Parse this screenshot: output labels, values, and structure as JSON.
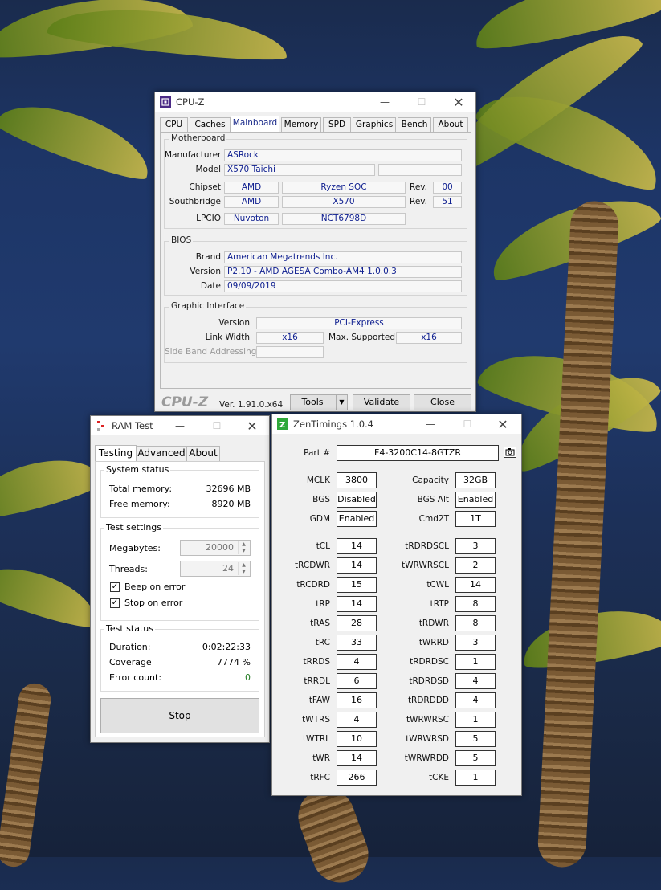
{
  "cpuz": {
    "title": "CPU-Z",
    "tabs": [
      "CPU",
      "Caches",
      "Mainboard",
      "Memory",
      "SPD",
      "Graphics",
      "Bench",
      "About"
    ],
    "selected_tab": "Mainboard",
    "motherboard": {
      "group": "Motherboard",
      "manufacturer_label": "Manufacturer",
      "manufacturer": "ASRock",
      "model_label": "Model",
      "model": "X570 Taichi",
      "chipset_label": "Chipset",
      "chipset_vendor": "AMD",
      "chipset_name": "Ryzen SOC",
      "chipset_rev_label": "Rev.",
      "chipset_rev": "00",
      "southbridge_label": "Southbridge",
      "southbridge_vendor": "AMD",
      "southbridge_name": "X570",
      "southbridge_rev_label": "Rev.",
      "southbridge_rev": "51",
      "lpcio_label": "LPCIO",
      "lpcio_vendor": "Nuvoton",
      "lpcio_name": "NCT6798D"
    },
    "bios": {
      "group": "BIOS",
      "brand_label": "Brand",
      "brand": "American Megatrends Inc.",
      "version_label": "Version",
      "version": "P2.10 - AMD AGESA Combo-AM4 1.0.0.3",
      "date_label": "Date",
      "date": "09/09/2019"
    },
    "graphic": {
      "group": "Graphic Interface",
      "version_label": "Version",
      "version": "PCI-Express",
      "link_label": "Link Width",
      "link": "x16",
      "max_label": "Max. Supported",
      "max": "x16",
      "sideband_label": "Side Band Addressing"
    },
    "footer": {
      "logo": "CPU-Z",
      "version": "Ver. 1.91.0.x64",
      "tools": "Tools",
      "validate": "Validate",
      "close": "Close"
    }
  },
  "ramtest": {
    "title": "RAM Test",
    "tabs": [
      "Testing",
      "Advanced",
      "About"
    ],
    "system_status": {
      "title": "System status",
      "total_label": "Total memory:",
      "total": "32696 MB",
      "free_label": "Free memory:",
      "free": "8920 MB"
    },
    "settings": {
      "title": "Test settings",
      "megabytes_label": "Megabytes:",
      "megabytes": "20000",
      "threads_label": "Threads:",
      "threads": "24",
      "beep_label": "Beep on error",
      "stop_label": "Stop on error",
      "beep": true,
      "stop": true
    },
    "test_status": {
      "title": "Test status",
      "duration_label": "Duration:",
      "duration": "0:02:22:33",
      "coverage_label": "Coverage",
      "coverage": "7774 %",
      "errors_label": "Error count:",
      "errors": "0"
    },
    "stop_button": "Stop"
  },
  "zentimings": {
    "title": "ZenTimings 1.0.4",
    "part_label": "Part #",
    "part": "F4-3200C14-8GTZR",
    "top_rows": [
      {
        "l_label": "MCLK",
        "l_val": "3800",
        "r_label": "Capacity",
        "r_val": "32GB"
      },
      {
        "l_label": "BGS",
        "l_val": "Disabled",
        "r_label": "BGS Alt",
        "r_val": "Enabled"
      },
      {
        "l_label": "GDM",
        "l_val": "Enabled",
        "r_label": "Cmd2T",
        "r_val": "1T"
      }
    ],
    "rows": [
      {
        "l_label": "tCL",
        "l_val": "14",
        "r_label": "tRDRDSCL",
        "r_val": "3"
      },
      {
        "l_label": "tRCDWR",
        "l_val": "14",
        "r_label": "tWRWRSCL",
        "r_val": "2"
      },
      {
        "l_label": "tRCDRD",
        "l_val": "15",
        "r_label": "tCWL",
        "r_val": "14"
      },
      {
        "l_label": "tRP",
        "l_val": "14",
        "r_label": "tRTP",
        "r_val": "8"
      },
      {
        "l_label": "tRAS",
        "l_val": "28",
        "r_label": "tRDWR",
        "r_val": "8"
      },
      {
        "l_label": "tRC",
        "l_val": "33",
        "r_label": "tWRRD",
        "r_val": "3"
      },
      {
        "l_label": "tRRDS",
        "l_val": "4",
        "r_label": "tRDRDSC",
        "r_val": "1"
      },
      {
        "l_label": "tRRDL",
        "l_val": "6",
        "r_label": "tRDRDSD",
        "r_val": "4"
      },
      {
        "l_label": "tFAW",
        "l_val": "16",
        "r_label": "tRDRDDD",
        "r_val": "4"
      },
      {
        "l_label": "tWTRS",
        "l_val": "4",
        "r_label": "tWRWRSC",
        "r_val": "1"
      },
      {
        "l_label": "tWTRL",
        "l_val": "10",
        "r_label": "tWRWRSD",
        "r_val": "5"
      },
      {
        "l_label": "tWR",
        "l_val": "14",
        "r_label": "tWRWRDD",
        "r_val": "5"
      },
      {
        "l_label": "tRFC",
        "l_val": "266",
        "r_label": "tCKE",
        "r_val": "1"
      }
    ]
  },
  "colors": {
    "value_text": "#102090",
    "zen_green": "#2fa83a",
    "error_count": "#1f7a1f"
  },
  "icons": [
    "cpuz-app-icon",
    "ramtest-app-icon",
    "zentimings-app-icon",
    "minimize-icon",
    "maximize-icon",
    "close-icon",
    "camera-icon",
    "dropdown-arrow-icon",
    "spin-arrows-icon",
    "checkmark-icon"
  ]
}
